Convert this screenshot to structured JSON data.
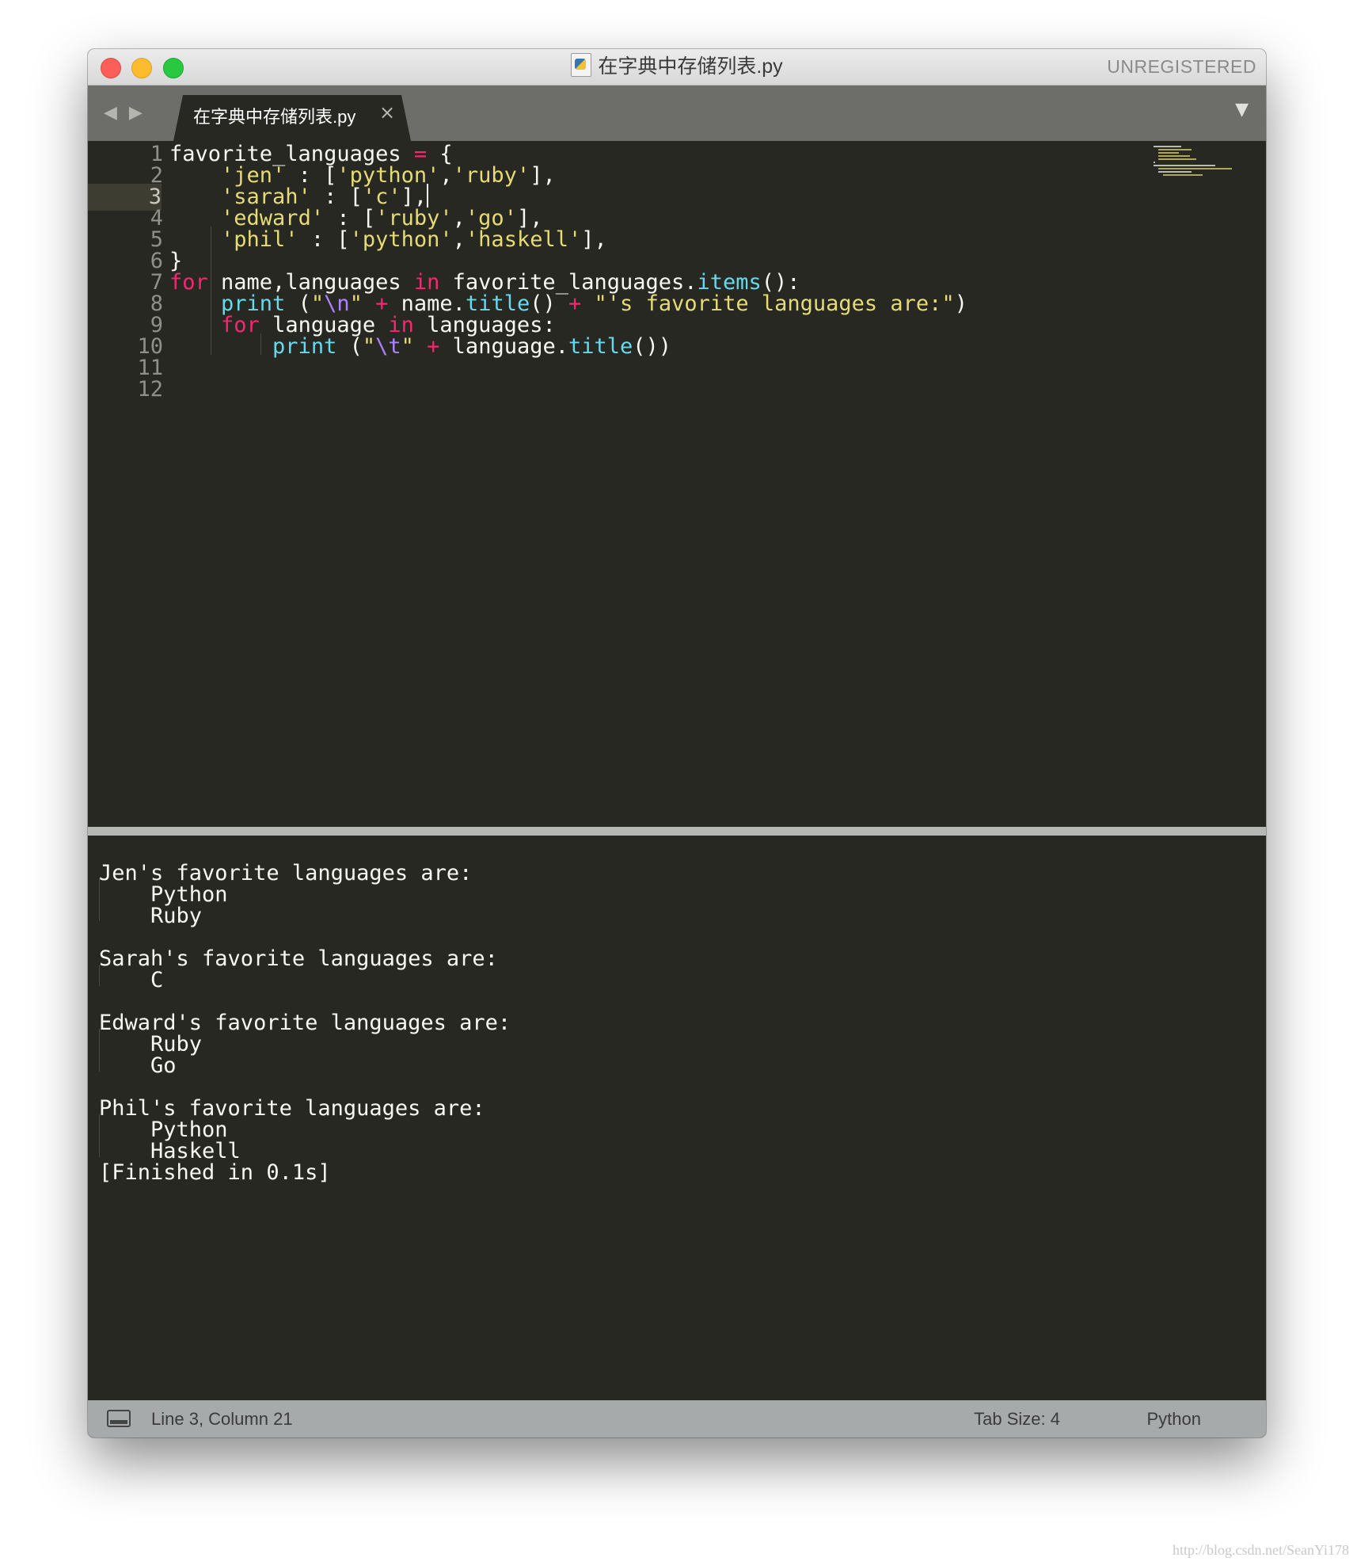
{
  "window": {
    "title": "在字典中存储列表.py",
    "registration": "UNREGISTERED"
  },
  "tabs": [
    {
      "label": "在字典中存储列表.py",
      "close_glyph": "×",
      "active": true
    }
  ],
  "tabbar": {
    "nav_glyph": "◀ ▶",
    "menu_glyph": "▼"
  },
  "editor": {
    "language": "Python",
    "current_line": 3,
    "line_numbers": [
      "1",
      "2",
      "3",
      "4",
      "5",
      "6",
      "7",
      "8",
      "9",
      "10",
      "11",
      "12"
    ],
    "code_lines": [
      "favorite_languages = {",
      "    'jen' : ['python','ruby'],",
      "    'sarah' : ['c'],",
      "    'edward' : ['ruby','go'],",
      "    'phil' : ['python','haskell'],",
      "}",
      "for name,languages in favorite_languages.items():",
      "    print (\"\\n\" + name.title() + \"'s favorite languages are:\")",
      "    for language in languages:",
      "        print (\"\\t\" + language.title())",
      "",
      ""
    ]
  },
  "output": {
    "lines": [
      "",
      "Jen's favorite languages are:",
      "    Python",
      "    Ruby",
      "",
      "Sarah's favorite languages are:",
      "    C",
      "",
      "Edward's favorite languages are:",
      "    Ruby",
      "    Go",
      "",
      "Phil's favorite languages are:",
      "    Python",
      "    Haskell",
      "[Finished in 0.1s]"
    ]
  },
  "statusbar": {
    "position": "Line 3, Column 21",
    "tab_size": "Tab Size: 4",
    "syntax": "Python"
  },
  "colors": {
    "background": "#272822",
    "keyword": "#f92672",
    "function": "#66d9ef",
    "string": "#e6db74",
    "escape": "#ae81ff",
    "text": "#f8f8f2"
  },
  "watermark": "http://blog.csdn.net/SeanYi178"
}
